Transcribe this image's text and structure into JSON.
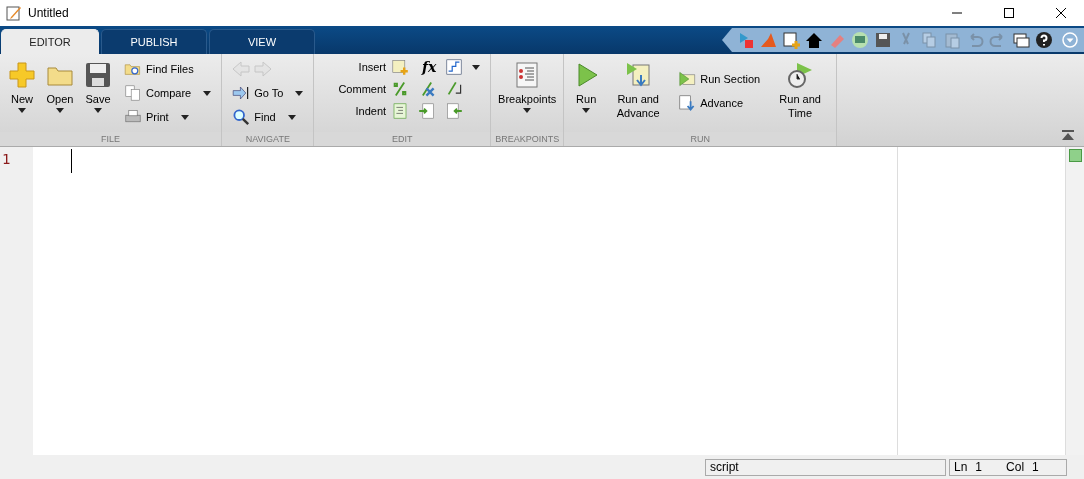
{
  "window": {
    "title": "Untitled"
  },
  "tabs": [
    {
      "label": "EDITOR",
      "selected": true
    },
    {
      "label": "PUBLISH",
      "selected": false
    },
    {
      "label": "VIEW",
      "selected": false
    }
  ],
  "quick_access": [
    {
      "disabled": false
    },
    {
      "disabled": false
    },
    {
      "disabled": false
    },
    {
      "disabled": false
    },
    {
      "disabled": false
    },
    {
      "disabled": false
    },
    {
      "disabled": false
    },
    {
      "disabled": true
    },
    {
      "disabled": true
    },
    {
      "disabled": true
    },
    {
      "disabled": true
    },
    {
      "disabled": true
    },
    {
      "disabled": false
    },
    {
      "disabled": false
    }
  ],
  "sections": [
    {
      "label": "FILE",
      "groups": [
        {
          "kind": "large",
          "label": "New",
          "menu": true
        },
        {
          "kind": "large",
          "label": "Open",
          "menu": true
        },
        {
          "kind": "large",
          "label": "Save",
          "menu": true
        },
        {
          "kind": "stack",
          "items": [
            {
              "kind": "button",
              "label": "Find Files",
              "menu": false
            },
            {
              "kind": "button",
              "label": "Compare",
              "menu": true
            },
            {
              "kind": "button",
              "label": "Print",
              "menu": true
            }
          ]
        }
      ]
    },
    {
      "label": "NAVIGATE",
      "groups": [
        {
          "kind": "stack",
          "items": [
            {
              "kind": "arrows",
              "disabled": true
            },
            {
              "kind": "button",
              "label": "Go To",
              "menu": true
            },
            {
              "kind": "button",
              "label": "Find",
              "menu": true
            }
          ]
        }
      ]
    },
    {
      "label": "EDIT",
      "groups": [
        {
          "kind": "grid",
          "rows": [
            {
              "label": "Insert",
              "symbol": "fx",
              "menu": true
            },
            {
              "label": "Comment",
              "menu": false
            },
            {
              "label": "Indent",
              "menu": false
            }
          ]
        }
      ]
    },
    {
      "label": "BREAKPOINTS",
      "groups": [
        {
          "kind": "large",
          "label": "Breakpoints",
          "menu": true
        }
      ]
    },
    {
      "label": "RUN",
      "groups": [
        {
          "kind": "large",
          "label": "Run",
          "menu": true
        },
        {
          "kind": "large",
          "label": "Run and Advance",
          "menu": false
        },
        {
          "kind": "stack",
          "items": [
            {
              "kind": "button",
              "label": "Run Section",
              "menu": false
            },
            {
              "kind": "button",
              "label": "Advance",
              "menu": false
            }
          ]
        },
        {
          "kind": "large",
          "label": "Run and Time",
          "menu": false
        }
      ]
    }
  ],
  "editor": {
    "line_numbers": [
      "1"
    ]
  },
  "status_bar": {
    "mode": "script",
    "ln_label": "Ln",
    "ln": "1",
    "col_label": "Col",
    "col": "1"
  }
}
